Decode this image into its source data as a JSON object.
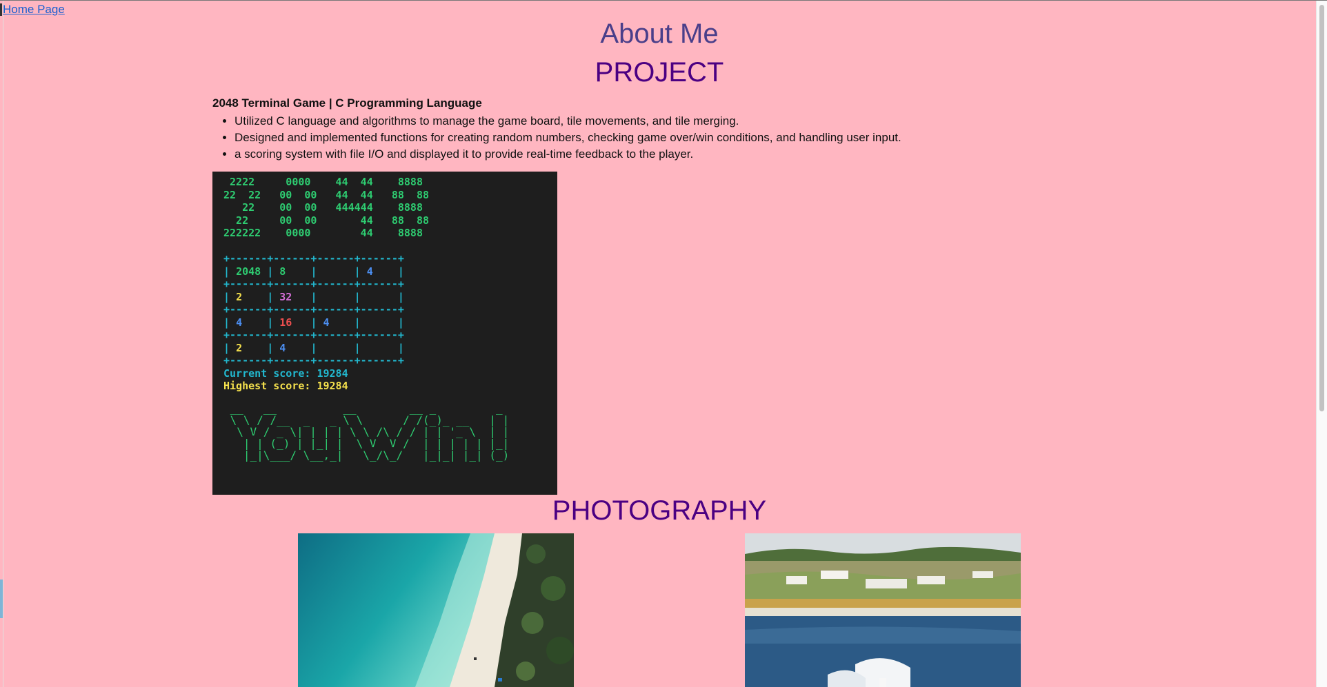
{
  "nav": {
    "home_link": "Home Page"
  },
  "header": {
    "title": "About Me"
  },
  "project": {
    "heading": "PROJECT",
    "title": "2048 Terminal Game | C Programming Language",
    "bullets": [
      "Utilized C language and algorithms to manage the game board, tile movements, and tile merging.",
      "Designed and implemented functions for creating random numbers, checking game over/win conditions, and handling user input.",
      "a scoring system with file I/O and displayed it to provide real-time feedback to the player."
    ],
    "terminal": {
      "banner": [
        " 2222     0000    44  44    8888",
        "22  22   00  00   44  44   88  88",
        "   22    00  00   444444    8888",
        "  22     00  00       44   88  88",
        "222222    0000        44    8888"
      ],
      "grid": [
        [
          "2048",
          "8",
          "",
          "4"
        ],
        [
          "2",
          "32",
          "",
          ""
        ],
        [
          "4",
          "16",
          "4",
          ""
        ],
        [
          "2",
          "4",
          "",
          ""
        ]
      ],
      "current_score_label": "Current score:",
      "current_score": "19284",
      "highest_score_label": "Highest score:",
      "highest_score": "19284",
      "win_art": [
        " __   __          __        __ _         _ ",
        " \\ \\ / /__  _   _ \\ \\      / /(_)_ __   | |",
        "  \\ V / _ \\| | | | \\ \\ /\\ / / | | '_ \\  | |",
        "   | | (_) | |_| |  \\ V  V /  | | | | | |_|",
        "   |_|\\___/ \\__,_|   \\_/\\_/   |_|_| |_| (_)"
      ]
    }
  },
  "photography": {
    "heading": "PHOTOGRAPHY",
    "photos": [
      {
        "subject": "aerial-beach-photo"
      },
      {
        "subject": "coastal-village-photo"
      }
    ]
  },
  "colors": {
    "background": "#ffb6c1",
    "about_title": "#4a3f8a",
    "section_heading": "#4b0082",
    "terminal_bg": "#1e1e1e"
  }
}
